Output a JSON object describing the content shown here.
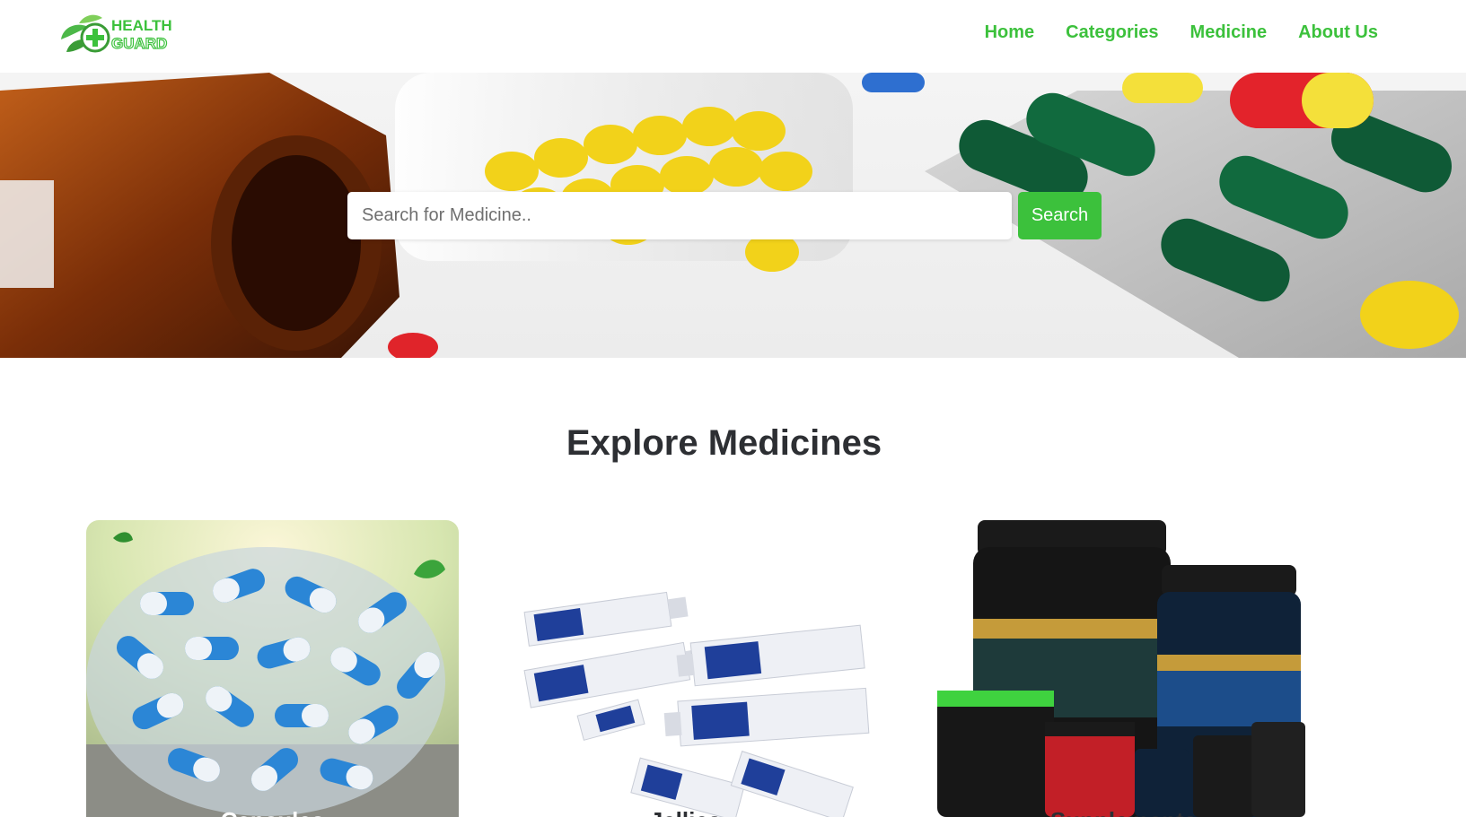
{
  "brand": {
    "logo_line1": "HEALTH",
    "logo_line2": "GUARD"
  },
  "nav": {
    "items": [
      {
        "label": "Home"
      },
      {
        "label": "Categories"
      },
      {
        "label": "Medicine"
      },
      {
        "label": "About Us"
      }
    ]
  },
  "search": {
    "placeholder": "Search for Medicine..",
    "value": "",
    "button_label": "Search"
  },
  "section": {
    "title": "Explore Medicines"
  },
  "cards": [
    {
      "label": "Capsules",
      "image": "blue-white-capsules-bowl"
    },
    {
      "label": "Jellies",
      "image": "surgilube-tubes"
    },
    {
      "label": "Supplements",
      "image": "protein-supplement-jars"
    }
  ],
  "colors": {
    "accent": "#3cc13c",
    "heading": "#2d2f33",
    "background": "#ffffff"
  }
}
